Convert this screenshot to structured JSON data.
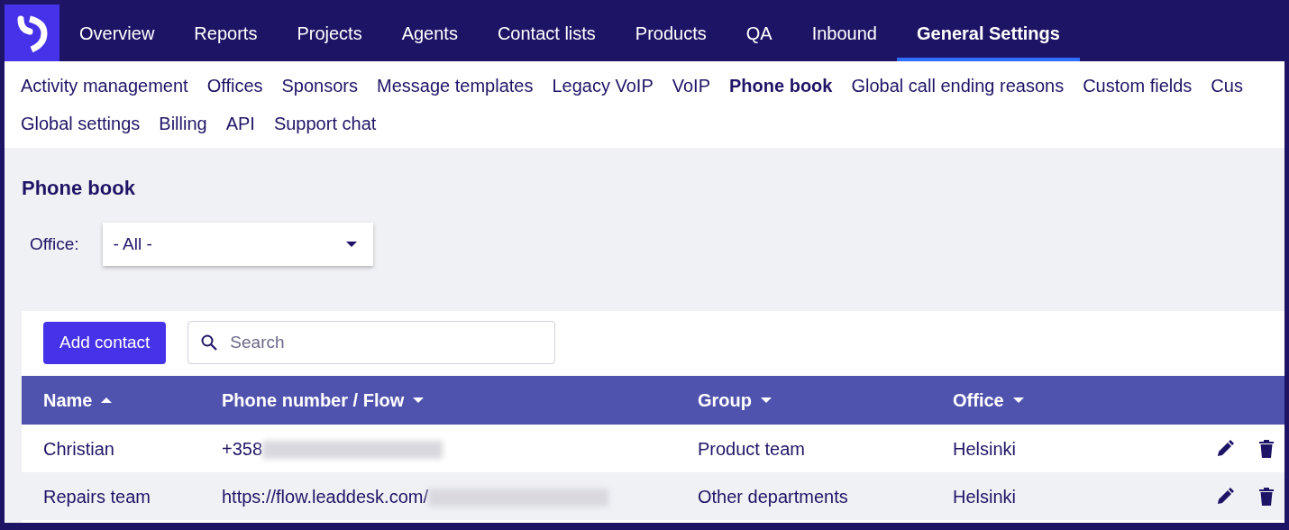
{
  "top_nav": {
    "items": [
      {
        "label": "Overview",
        "selected": false
      },
      {
        "label": "Reports",
        "selected": false
      },
      {
        "label": "Projects",
        "selected": false
      },
      {
        "label": "Agents",
        "selected": false
      },
      {
        "label": "Contact lists",
        "selected": false
      },
      {
        "label": "Products",
        "selected": false
      },
      {
        "label": "QA",
        "selected": false
      },
      {
        "label": "Inbound",
        "selected": false
      },
      {
        "label": "General Settings",
        "selected": true
      }
    ]
  },
  "sub_nav": {
    "items": [
      {
        "label": "Activity management",
        "selected": false
      },
      {
        "label": "Offices",
        "selected": false
      },
      {
        "label": "Sponsors",
        "selected": false
      },
      {
        "label": "Message templates",
        "selected": false
      },
      {
        "label": "Legacy VoIP",
        "selected": false
      },
      {
        "label": "VoIP",
        "selected": false
      },
      {
        "label": "Phone book",
        "selected": true
      },
      {
        "label": "Global call ending reasons",
        "selected": false
      },
      {
        "label": "Custom fields",
        "selected": false
      },
      {
        "label": "Cus",
        "selected": false
      },
      {
        "label": "Global settings",
        "selected": false
      },
      {
        "label": "Billing",
        "selected": false
      },
      {
        "label": "API",
        "selected": false
      },
      {
        "label": "Support chat",
        "selected": false
      }
    ]
  },
  "page_title": "Phone book",
  "office_filter": {
    "label": "Office:",
    "value": "- All -"
  },
  "toolbar": {
    "add_button": "Add contact",
    "search": {
      "placeholder": "Search"
    }
  },
  "table": {
    "columns": [
      {
        "label": "Name",
        "sort_ascending": true
      },
      {
        "label": "Phone number / Flow",
        "sort_ascending": false
      },
      {
        "label": "Group",
        "sort_ascending": false
      },
      {
        "label": "Office",
        "sort_ascending": false
      }
    ],
    "rows": [
      {
        "cells": [
          "Christian",
          "+358",
          "Product team",
          "Helsinki"
        ],
        "redacted": true
      },
      {
        "cells": [
          "Repairs team",
          "https://flow.leaddesk.com/",
          "Other departments",
          "Helsinki"
        ],
        "redacted": true
      }
    ]
  }
}
